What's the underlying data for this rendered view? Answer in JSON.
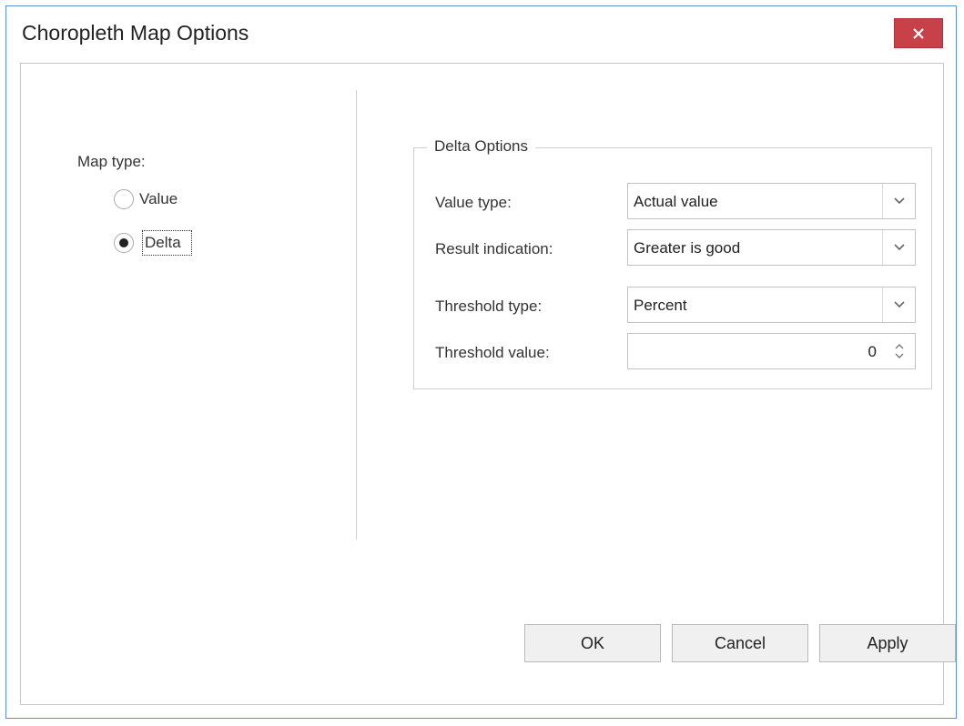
{
  "dialog": {
    "title": "Choropleth Map Options",
    "close_icon": "close-icon"
  },
  "map_type": {
    "label": "Map type:",
    "options": [
      {
        "label": "Value",
        "selected": false
      },
      {
        "label": "Delta",
        "selected": true
      }
    ]
  },
  "delta_options": {
    "title": "Delta Options",
    "value_type": {
      "label": "Value type:",
      "value": "Actual value"
    },
    "result_indication": {
      "label": "Result indication:",
      "value": "Greater is good"
    },
    "threshold_type": {
      "label": "Threshold type:",
      "value": "Percent"
    },
    "threshold_value": {
      "label": "Threshold value:",
      "value": "0"
    }
  },
  "buttons": {
    "ok": "OK",
    "cancel": "Cancel",
    "apply": "Apply"
  },
  "colors": {
    "close_button": "#c94148",
    "window_border": "#5b8fd0"
  }
}
